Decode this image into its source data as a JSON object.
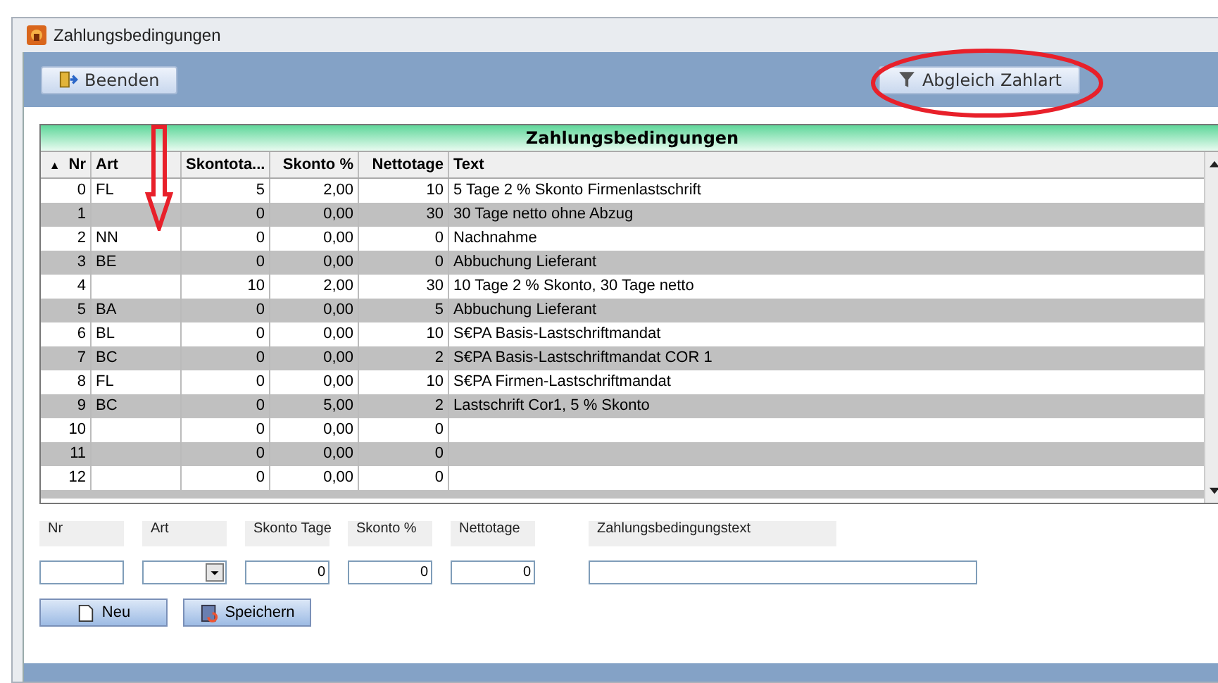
{
  "window": {
    "title": "Zahlungsbedingungen"
  },
  "toolbar": {
    "left_button": "Beenden",
    "right_button": "Abgleich Zahlart"
  },
  "grid": {
    "title": "Zahlungsbedingungen",
    "columns": [
      {
        "label": "Nr",
        "sort_indicator": "▲"
      },
      {
        "label": "Art"
      },
      {
        "label": "Skontota..."
      },
      {
        "label": "Skonto %"
      },
      {
        "label": "Nettotage"
      },
      {
        "label": "Text"
      }
    ],
    "rows": [
      [
        "0",
        "FL",
        "5",
        "2,00",
        "10",
        "5 Tage 2 % Skonto Firmenlastschrift"
      ],
      [
        "1",
        null,
        "0",
        "0,00",
        "30",
        "30 Tage netto ohne Abzug"
      ],
      [
        "2",
        "NN",
        "0",
        "0,00",
        "0",
        "Nachnahme"
      ],
      [
        "3",
        "BE",
        "0",
        "0,00",
        "0",
        "Abbuchung Lieferant"
      ],
      [
        "4",
        null,
        "10",
        "2,00",
        "30",
        "10 Tage 2 % Skonto, 30 Tage netto"
      ],
      [
        "5",
        "BA",
        "0",
        "0,00",
        "5",
        "Abbuchung Lieferant"
      ],
      [
        "6",
        "BL",
        "0",
        "0,00",
        "10",
        "S€PA Basis-Lastschriftmandat"
      ],
      [
        "7",
        "BC",
        "0",
        "0,00",
        "2",
        "S€PA Basis-Lastschriftmandat  COR 1"
      ],
      [
        "8",
        "FL",
        "0",
        "0,00",
        "10",
        "S€PA Firmen-Lastschriftmandat"
      ],
      [
        "9",
        "BC",
        "0",
        "5,00",
        "2",
        "Lastschrift Cor1, 5 % Skonto"
      ],
      [
        "10",
        null,
        "0",
        "0,00",
        "0",
        null
      ],
      [
        "11",
        null,
        "0",
        "0,00",
        "0",
        null
      ],
      [
        "12",
        null,
        "0",
        "0,00",
        "0",
        null
      ]
    ]
  },
  "form": {
    "fields": [
      {
        "label": "Nr",
        "kind": "text"
      },
      {
        "label": "Art",
        "kind": "dropdown"
      },
      {
        "label": "Skonto Tage",
        "kind": "number",
        "value": "0"
      },
      {
        "label": "Skonto %",
        "kind": "number",
        "value": "0"
      },
      {
        "label": "Nettotage",
        "kind": "number",
        "value": "0"
      },
      {
        "label": "Zahlungsbedingungstext",
        "kind": "wide"
      }
    ]
  },
  "buttons": [
    "Neu",
    "Speichern"
  ]
}
